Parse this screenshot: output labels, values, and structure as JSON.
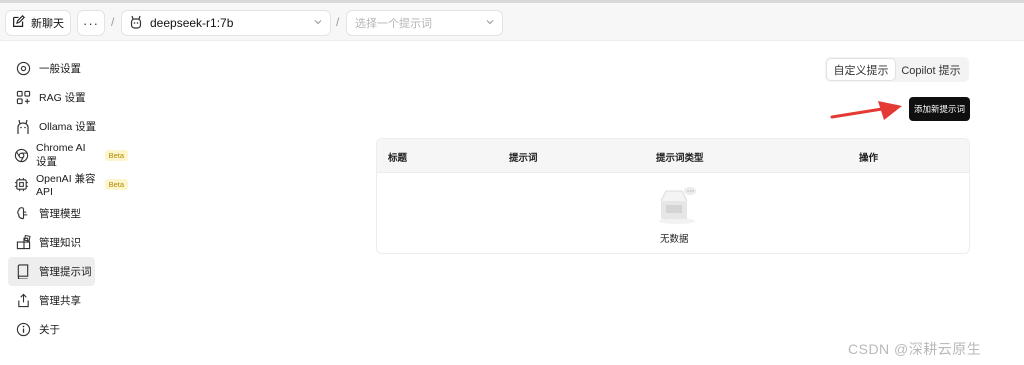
{
  "header": {
    "new_chat_label": "新聊天",
    "more_label": "···",
    "separator": "/",
    "model_select": {
      "value": "deepseek-r1:7b"
    },
    "prompt_select": {
      "placeholder": "选择一个提示词"
    }
  },
  "sidebar": {
    "items": [
      {
        "label": "一般设置",
        "icon": "settings-icon"
      },
      {
        "label": "RAG 设置",
        "icon": "rag-icon"
      },
      {
        "label": "Ollama 设置",
        "icon": "ollama-icon"
      },
      {
        "label": "Chrome AI 设置",
        "icon": "chrome-icon",
        "badge": "Beta"
      },
      {
        "label": "OpenAI 兼容 API",
        "icon": "chip-icon",
        "badge": "Beta"
      },
      {
        "label": "管理模型",
        "icon": "brain-icon"
      },
      {
        "label": "管理知识",
        "icon": "blocks-icon"
      },
      {
        "label": "管理提示词",
        "icon": "book-icon",
        "active": true
      },
      {
        "label": "管理共享",
        "icon": "share-icon"
      },
      {
        "label": "关于",
        "icon": "info-icon"
      }
    ]
  },
  "tabs": {
    "custom": "自定义提示",
    "copilot": "Copilot 提示"
  },
  "add_prompt_label": "添加新提示词",
  "table": {
    "columns": [
      "标题",
      "提示词",
      "提示词类型",
      "操作"
    ],
    "empty_text": "无数据"
  },
  "watermark": "CSDN @深耕云原生",
  "colors": {
    "accent_dark": "#0f0f0f",
    "arrow_red": "#e53935",
    "beta_bg": "#fdf6cc",
    "beta_text": "#b08a00"
  }
}
